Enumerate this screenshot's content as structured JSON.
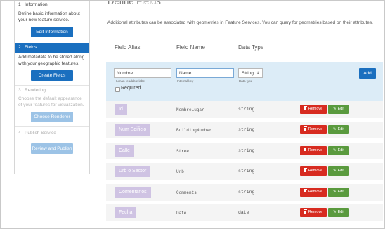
{
  "sidebar": {
    "steps": [
      {
        "number": "1",
        "title": "Information",
        "description": "Define basic information about your new feature service.",
        "button": "Edit Information"
      },
      {
        "number": "2",
        "title": "Fields",
        "description": "Add metadata to be stored along with your geographic features.",
        "button": "Create Fields"
      },
      {
        "number": "3",
        "title": "Rendering",
        "description": "Choose the default appearance of your features for visualization.",
        "button": "Choose Renderer"
      },
      {
        "number": "4",
        "title": "Publish Service",
        "description": "",
        "button": "Review and Publish"
      }
    ]
  },
  "main": {
    "title": "Define Fields",
    "intro": "Additional attributes can be associated with geometries in Feature Services. You can query for geometries based on their attributes.",
    "columns": {
      "alias": "Field Alias",
      "name": "Field Name",
      "type": "Data Type"
    },
    "new_field": {
      "alias_value": "Nombre",
      "alias_hint": "Human readable label",
      "name_value": "Name",
      "name_hint": "Internal key",
      "type_value": "String",
      "type_hint": "Data type",
      "required_label": "Required",
      "add_label": "Add"
    },
    "remove_label": "Remove",
    "edit_label": "Edit",
    "fields": [
      {
        "alias": "Id",
        "name": "NombreLugar",
        "type": "string"
      },
      {
        "alias": "Num Edificio",
        "name": "BuildingNumber",
        "type": "string"
      },
      {
        "alias": "Calle",
        "name": "Street",
        "type": "string"
      },
      {
        "alias": "Urb o Sector",
        "name": "Urb",
        "type": "string"
      },
      {
        "alias": "Comentarios",
        "name": "Comments",
        "type": "string"
      },
      {
        "alias": "Fecha",
        "name": "Date",
        "type": "date"
      }
    ]
  },
  "colors": {
    "primary": "#1a6fbf",
    "remove": "#d72b20",
    "edit": "#5a9a3e",
    "alias_chip": "#cfc3e3",
    "add_bar": "#dcecf7"
  }
}
